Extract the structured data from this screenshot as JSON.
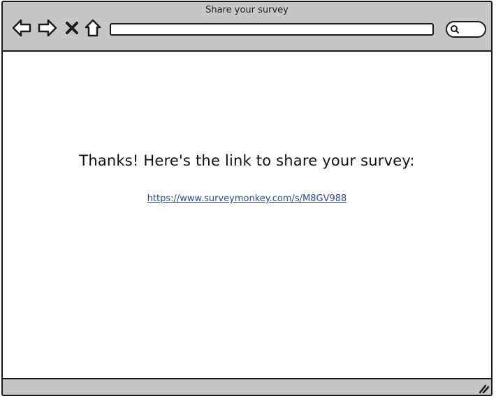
{
  "window": {
    "title": "Share your survey"
  },
  "toolbar": {
    "back_icon": "back-arrow-icon",
    "forward_icon": "forward-arrow-icon",
    "stop_icon": "close-x-icon",
    "home_icon": "home-icon"
  },
  "address_bar": {
    "value": ""
  },
  "search": {
    "icon": "search-icon"
  },
  "content": {
    "message": "Thanks! Here's the link to share your survey:",
    "link_text": "https://www.surveymonkey.com/s/M8GV988"
  },
  "statusbar": {
    "grip_icon": "resize-grip-icon"
  },
  "colors": {
    "chrome": "#c6c6c6",
    "border": "#1a1a1a",
    "link": "#1f4e9c"
  }
}
